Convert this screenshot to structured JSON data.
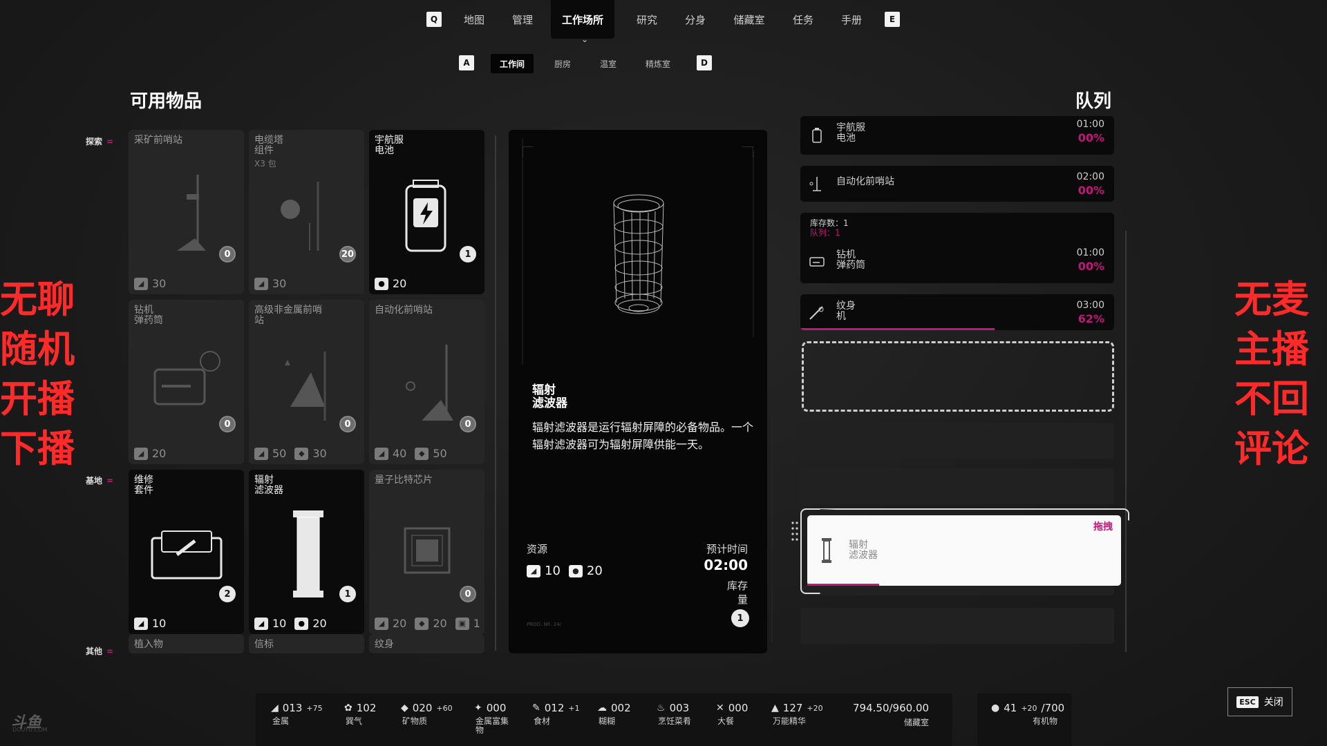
{
  "nav": {
    "key_left": "Q",
    "key_right": "E",
    "tabs": [
      "地图",
      "管理",
      "工作场所",
      "研究",
      "分身",
      "储藏室",
      "任务",
      "手册"
    ],
    "active": "工作场所"
  },
  "subnav": {
    "key_left": "A",
    "key_right": "D",
    "tabs": [
      "工作间",
      "厨房",
      "温室",
      "精炼室"
    ],
    "active": "工作间"
  },
  "available": {
    "title": "可用物品",
    "categories": [
      "探索",
      "基地",
      "其他"
    ],
    "items": [
      {
        "name": "采矿前哨站",
        "sub": "",
        "count": "0",
        "costs": [
          {
            "icon": "metal-icon",
            "value": "30"
          }
        ],
        "available": false
      },
      {
        "name": "电缆塔\n组件",
        "sub": "X3 包",
        "count": "20",
        "costs": [
          {
            "icon": "metal-icon",
            "value": "30"
          }
        ],
        "available": false
      },
      {
        "name": "宇航服\n电池",
        "sub": "",
        "count": "1",
        "costs": [
          {
            "icon": "water-icon",
            "value": "20"
          }
        ],
        "available": true
      },
      {
        "name": "钻机\n弹药筒",
        "sub": "",
        "count": "0",
        "costs": [
          {
            "icon": "metal-icon",
            "value": "20"
          }
        ],
        "available": false
      },
      {
        "name": "高级非金属前哨\n站",
        "sub": "",
        "count": "0",
        "costs": [
          {
            "icon": "metal-icon",
            "value": "50"
          },
          {
            "icon": "mineral-icon",
            "value": "30"
          }
        ],
        "available": false
      },
      {
        "name": "自动化前哨站",
        "sub": "",
        "count": "0",
        "costs": [
          {
            "icon": "metal-icon",
            "value": "40"
          },
          {
            "icon": "mineral-icon",
            "value": "50"
          }
        ],
        "available": false
      },
      {
        "name": "维修\n套件",
        "sub": "",
        "count": "2",
        "costs": [
          {
            "icon": "metal-icon",
            "value": "10"
          }
        ],
        "available": true
      },
      {
        "name": "辐射\n滤波器",
        "sub": "",
        "count": "1",
        "costs": [
          {
            "icon": "metal-icon",
            "value": "10"
          },
          {
            "icon": "water-icon",
            "value": "20"
          }
        ],
        "available": true
      },
      {
        "name": "量子比特芯片",
        "sub": "",
        "count": "0",
        "costs": [
          {
            "icon": "metal-icon",
            "value": "20"
          },
          {
            "icon": "mineral-icon",
            "value": "20"
          },
          {
            "icon": "chip-icon",
            "value": "1"
          }
        ],
        "available": false
      }
    ],
    "other_items": [
      "植入物",
      "信标",
      "纹身"
    ]
  },
  "detail": {
    "name": "辐射\n滤波器",
    "description": "辐射滤波器是运行辐射屏障的必备物品。一个辐射滤波器可为辐射屏障供能一天。",
    "resources_label": "资源",
    "costs": [
      {
        "icon": "metal-icon",
        "value": "10"
      },
      {
        "icon": "water-icon",
        "value": "20"
      }
    ],
    "time_label": "预计时间",
    "time": "02:00",
    "stock_label": "库存\n量",
    "stock": "1",
    "code": "PROD. NR. 24/"
  },
  "queue": {
    "title": "队列",
    "items": [
      {
        "name": "宇航服\n电池",
        "time": "01:00",
        "pct": "00%",
        "progress": 0
      },
      {
        "name": "自动化前哨站",
        "time": "02:00",
        "pct": "00%",
        "progress": 0
      },
      {
        "name": "钻机\n弹药筒",
        "time": "01:00",
        "pct": "00%",
        "progress": 0,
        "stock_line": "库存数：1",
        "queue_line": "队列：1"
      },
      {
        "name": "纹身\n机",
        "time": "03:00",
        "pct": "62%",
        "progress": 0.62
      }
    ],
    "drag": {
      "label": "拖拽",
      "name": "辐射\n滤波器",
      "progress": 0.23
    }
  },
  "overlay": {
    "left": "无聊\n随机\n开播\n下播",
    "right": "无麦\n主播\n不回\n评论"
  },
  "resources": [
    {
      "icon": "metal-icon",
      "value": "013",
      "delta": "+75",
      "label": "金属"
    },
    {
      "icon": "gear-icon",
      "value": "102",
      "delta": "",
      "label": "巽气"
    },
    {
      "icon": "mineral-icon",
      "value": "020",
      "delta": "+60",
      "label": "矿物质"
    },
    {
      "icon": "rich-metal-icon",
      "value": "000",
      "delta": "",
      "label": "金属富集\n物"
    },
    {
      "icon": "food-icon",
      "value": "012",
      "delta": "+1",
      "label": "食材"
    },
    {
      "icon": "paste-icon",
      "value": "002",
      "delta": "",
      "label": "糊糊"
    },
    {
      "icon": "dish-icon",
      "value": "003",
      "delta": "",
      "label": "烹饪菜肴"
    },
    {
      "icon": "feast-icon",
      "value": "000",
      "delta": "",
      "label": "大餐"
    },
    {
      "icon": "essence-icon",
      "value": "127",
      "delta": "+20",
      "label": "万能精华"
    }
  ],
  "storage": {
    "value": "794.50/960.00",
    "label": "储藏室"
  },
  "organic": {
    "value": "41",
    "delta": "+20",
    "max": "/700",
    "label": "有机物"
  },
  "close": {
    "key": "ESC",
    "label": "关闭"
  },
  "logo": {
    "text": "斗鱼",
    "sub": "DOUYU.COM"
  }
}
